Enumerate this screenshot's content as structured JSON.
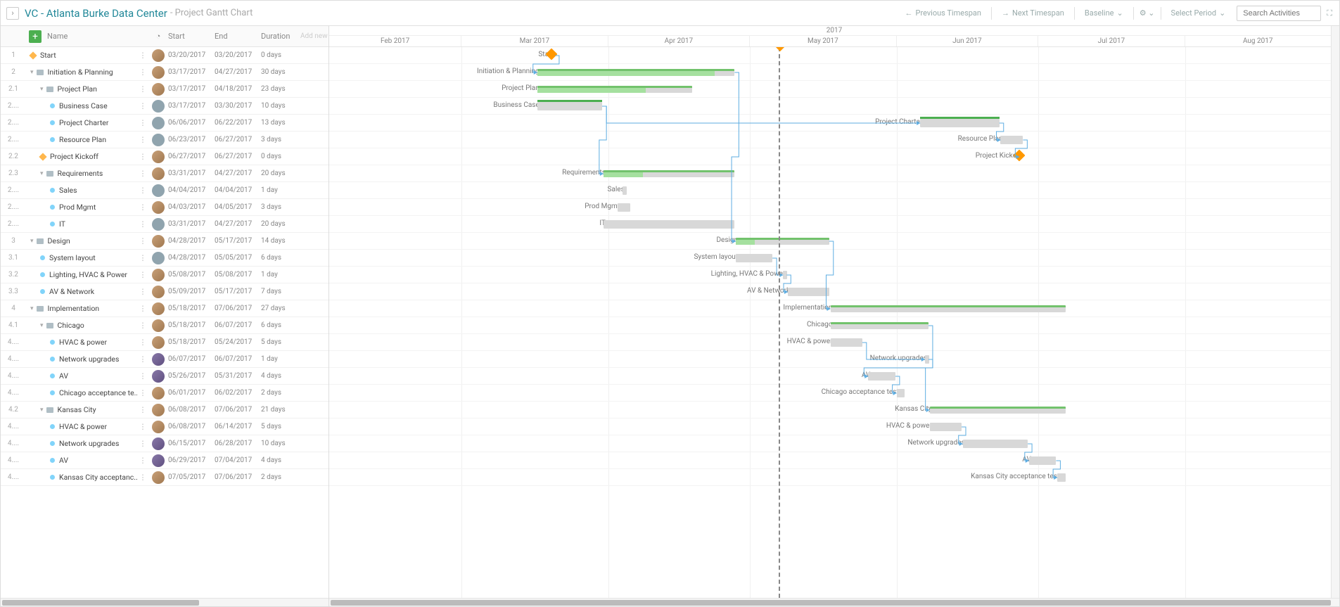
{
  "header": {
    "title_main": "VC - Atlanta Burke Data Center",
    "title_sub": "- Project Gantt Chart",
    "prev_timespan": "Previous Timespan",
    "next_timespan": "Next Timespan",
    "baseline": "Baseline",
    "select_period": "Select Period",
    "search_placeholder": "Search Activities"
  },
  "columns": {
    "name": "Name",
    "start": "Start",
    "end": "End",
    "duration": "Duration",
    "add_new": "Add new"
  },
  "timeline": {
    "year": "2017",
    "months": [
      "Feb 2017",
      "Mar 2017",
      "Apr 2017",
      "May 2017",
      "Jun 2017",
      "Jul 2017",
      "Aug 2017"
    ]
  },
  "tasks": [
    {
      "num": "1",
      "name": "Start",
      "start": "03/20/2017",
      "end": "03/20/2017",
      "dur": "0 days",
      "type": "milestone",
      "indent": 0,
      "avatar": "photo"
    },
    {
      "num": "2",
      "name": "Initiation & Planning",
      "start": "03/17/2017",
      "end": "04/27/2017",
      "dur": "30 days",
      "type": "summary",
      "indent": 0,
      "avatar": "photo"
    },
    {
      "num": "2.1",
      "name": "Project Plan",
      "start": "03/17/2017",
      "end": "04/18/2017",
      "dur": "23 days",
      "type": "subsummary",
      "indent": 1,
      "avatar": "photo"
    },
    {
      "num": "2....",
      "name": "Business Case",
      "start": "03/17/2017",
      "end": "03/30/2017",
      "dur": "10 days",
      "type": "task",
      "indent": 2,
      "avatar": "gray"
    },
    {
      "num": "2....",
      "name": "Project Charter",
      "start": "06/06/2017",
      "end": "06/22/2017",
      "dur": "13 days",
      "type": "task",
      "indent": 2,
      "avatar": "gray"
    },
    {
      "num": "2....",
      "name": "Resource Plan",
      "start": "06/23/2017",
      "end": "06/27/2017",
      "dur": "3 days",
      "type": "task",
      "indent": 2,
      "avatar": "gray"
    },
    {
      "num": "2.2",
      "name": "Project Kickoff",
      "start": "06/27/2017",
      "end": "06/27/2017",
      "dur": "0 days",
      "type": "milestone",
      "indent": 1,
      "avatar": "photo"
    },
    {
      "num": "2.3",
      "name": "Requirements",
      "start": "03/31/2017",
      "end": "04/27/2017",
      "dur": "20 days",
      "type": "subsummary",
      "indent": 1,
      "avatar": "photo"
    },
    {
      "num": "2....",
      "name": "Sales",
      "start": "04/04/2017",
      "end": "04/04/2017",
      "dur": "1 day",
      "type": "task",
      "indent": 2,
      "avatar": "gray"
    },
    {
      "num": "2....",
      "name": "Prod Mgmt",
      "start": "04/03/2017",
      "end": "04/05/2017",
      "dur": "3 days",
      "type": "task",
      "indent": 2,
      "avatar": "photo"
    },
    {
      "num": "2....",
      "name": "IT",
      "start": "03/31/2017",
      "end": "04/27/2017",
      "dur": "20 days",
      "type": "task",
      "indent": 2,
      "avatar": "gray"
    },
    {
      "num": "3",
      "name": "Design",
      "start": "04/28/2017",
      "end": "05/17/2017",
      "dur": "14 days",
      "type": "summary",
      "indent": 0,
      "avatar": "photo"
    },
    {
      "num": "3.1",
      "name": "System layout",
      "start": "04/28/2017",
      "end": "05/05/2017",
      "dur": "6 days",
      "type": "task",
      "indent": 1,
      "avatar": "gray"
    },
    {
      "num": "3.2",
      "name": "Lighting, HVAC & Power",
      "start": "05/08/2017",
      "end": "05/08/2017",
      "dur": "1 day",
      "type": "task",
      "indent": 1,
      "avatar": "photo"
    },
    {
      "num": "3.3",
      "name": "AV & Network",
      "start": "05/09/2017",
      "end": "05/17/2017",
      "dur": "7 days",
      "type": "task",
      "indent": 1,
      "avatar": "photo"
    },
    {
      "num": "4",
      "name": "Implementation",
      "start": "05/18/2017",
      "end": "07/06/2017",
      "dur": "27 days",
      "type": "summary",
      "indent": 0,
      "avatar": "photo"
    },
    {
      "num": "4.1",
      "name": "Chicago",
      "start": "05/18/2017",
      "end": "06/07/2017",
      "dur": "6 days",
      "type": "subsummary",
      "indent": 1,
      "avatar": "photo"
    },
    {
      "num": "4....",
      "name": "HVAC & power",
      "start": "05/18/2017",
      "end": "05/24/2017",
      "dur": "5 days",
      "type": "task",
      "indent": 2,
      "avatar": "photo"
    },
    {
      "num": "4....",
      "name": "Network upgrades",
      "start": "06/07/2017",
      "end": "06/07/2017",
      "dur": "1 day",
      "type": "task",
      "indent": 2,
      "avatar": "photo2"
    },
    {
      "num": "4....",
      "name": "AV",
      "start": "05/26/2017",
      "end": "05/31/2017",
      "dur": "4 days",
      "type": "task",
      "indent": 2,
      "avatar": "photo2"
    },
    {
      "num": "4....",
      "name": "Chicago acceptance te..",
      "start": "06/01/2017",
      "end": "06/02/2017",
      "dur": "2 days",
      "type": "task",
      "indent": 2,
      "avatar": "photo"
    },
    {
      "num": "4.2",
      "name": "Kansas City",
      "start": "06/08/2017",
      "end": "07/06/2017",
      "dur": "21 days",
      "type": "subsummary",
      "indent": 1,
      "avatar": "photo"
    },
    {
      "num": "4....",
      "name": "HVAC & power",
      "start": "06/08/2017",
      "end": "06/14/2017",
      "dur": "5 days",
      "type": "task",
      "indent": 2,
      "avatar": "photo"
    },
    {
      "num": "4....",
      "name": "Network upgrades",
      "start": "06/15/2017",
      "end": "06/28/2017",
      "dur": "10 days",
      "type": "task",
      "indent": 2,
      "avatar": "photo2"
    },
    {
      "num": "4....",
      "name": "AV",
      "start": "06/29/2017",
      "end": "07/04/2017",
      "dur": "4 days",
      "type": "task",
      "indent": 2,
      "avatar": "photo2"
    },
    {
      "num": "4....",
      "name": "Kansas City acceptanc...",
      "start": "07/05/2017",
      "end": "07/06/2017",
      "dur": "2 days",
      "type": "task",
      "indent": 2,
      "avatar": "photo"
    }
  ],
  "chart_data": {
    "type": "gantt",
    "time_range": [
      "2017-02-01",
      "2017-08-31"
    ],
    "today": "2017-05-07",
    "tasks": [
      {
        "id": 1,
        "name": "Start",
        "start": "2017-03-20",
        "end": "2017-03-20",
        "type": "milestone"
      },
      {
        "id": 2,
        "name": "Initiation & Planning",
        "start": "2017-03-17",
        "end": "2017-04-27",
        "type": "summary",
        "progress": 0.9
      },
      {
        "id": 3,
        "name": "Project Plan",
        "start": "2017-03-17",
        "end": "2017-04-18",
        "type": "summary",
        "progress": 0.7
      },
      {
        "id": 4,
        "name": "Business Case",
        "start": "2017-03-17",
        "end": "2017-03-30",
        "type": "task",
        "progress": 1.0
      },
      {
        "id": 5,
        "name": "Project Charter",
        "start": "2017-06-06",
        "end": "2017-06-22",
        "type": "task",
        "progress": 1.0
      },
      {
        "id": 6,
        "name": "Resource Plan",
        "start": "2017-06-23",
        "end": "2017-06-27",
        "type": "task",
        "progress": 0
      },
      {
        "id": 7,
        "name": "Project Kickoff",
        "start": "2017-06-27",
        "end": "2017-06-27",
        "type": "milestone"
      },
      {
        "id": 8,
        "name": "Requirements",
        "start": "2017-03-31",
        "end": "2017-04-27",
        "type": "summary",
        "progress": 0.3
      },
      {
        "id": 9,
        "name": "Sales",
        "start": "2017-04-04",
        "end": "2017-04-04",
        "type": "task"
      },
      {
        "id": 10,
        "name": "Prod Mgmt",
        "start": "2017-04-03",
        "end": "2017-04-05",
        "type": "task"
      },
      {
        "id": 11,
        "name": "IT",
        "start": "2017-03-31",
        "end": "2017-04-27",
        "type": "task"
      },
      {
        "id": 12,
        "name": "Design",
        "start": "2017-04-28",
        "end": "2017-05-17",
        "type": "summary",
        "progress": 0.2
      },
      {
        "id": 13,
        "name": "System layout",
        "start": "2017-04-28",
        "end": "2017-05-05",
        "type": "task"
      },
      {
        "id": 14,
        "name": "Lighting, HVAC & Power",
        "start": "2017-05-08",
        "end": "2017-05-08",
        "type": "task"
      },
      {
        "id": 15,
        "name": "AV & Network",
        "start": "2017-05-09",
        "end": "2017-05-17",
        "type": "task"
      },
      {
        "id": 16,
        "name": "Implementation",
        "start": "2017-05-18",
        "end": "2017-07-06",
        "type": "summary",
        "progress": 0
      },
      {
        "id": 17,
        "name": "Chicago",
        "start": "2017-05-18",
        "end": "2017-06-07",
        "type": "summary"
      },
      {
        "id": 18,
        "name": "HVAC & power",
        "start": "2017-05-18",
        "end": "2017-05-24",
        "type": "task"
      },
      {
        "id": 19,
        "name": "Network upgrades",
        "start": "2017-06-07",
        "end": "2017-06-07",
        "type": "task"
      },
      {
        "id": 20,
        "name": "AV",
        "start": "2017-05-26",
        "end": "2017-05-31",
        "type": "task"
      },
      {
        "id": 21,
        "name": "Chicago acceptance test",
        "start": "2017-06-01",
        "end": "2017-06-02",
        "type": "task"
      },
      {
        "id": 22,
        "name": "Kansas City",
        "start": "2017-06-08",
        "end": "2017-07-06",
        "type": "summary"
      },
      {
        "id": 23,
        "name": "HVAC & power",
        "start": "2017-06-08",
        "end": "2017-06-14",
        "type": "task"
      },
      {
        "id": 24,
        "name": "Network upgrades",
        "start": "2017-06-15",
        "end": "2017-06-28",
        "type": "task"
      },
      {
        "id": 25,
        "name": "AV",
        "start": "2017-06-29",
        "end": "2017-07-04",
        "type": "task"
      },
      {
        "id": 26,
        "name": "Kansas City acceptance test",
        "start": "2017-07-05",
        "end": "2017-07-06",
        "type": "task"
      }
    ],
    "dependencies": [
      {
        "from": 1,
        "to": 2
      },
      {
        "from": 4,
        "to": 5
      },
      {
        "from": 4,
        "to": 8
      },
      {
        "from": 5,
        "to": 6
      },
      {
        "from": 6,
        "to": 7
      },
      {
        "from": 2,
        "to": 12
      },
      {
        "from": 13,
        "to": 14
      },
      {
        "from": 14,
        "to": 15
      },
      {
        "from": 12,
        "to": 16
      },
      {
        "from": 18,
        "to": 19
      },
      {
        "from": 19,
        "to": 20
      },
      {
        "from": 20,
        "to": 21
      },
      {
        "from": 17,
        "to": 22
      },
      {
        "from": 23,
        "to": 24
      },
      {
        "from": 24,
        "to": 25
      },
      {
        "from": 25,
        "to": 26
      }
    ]
  }
}
